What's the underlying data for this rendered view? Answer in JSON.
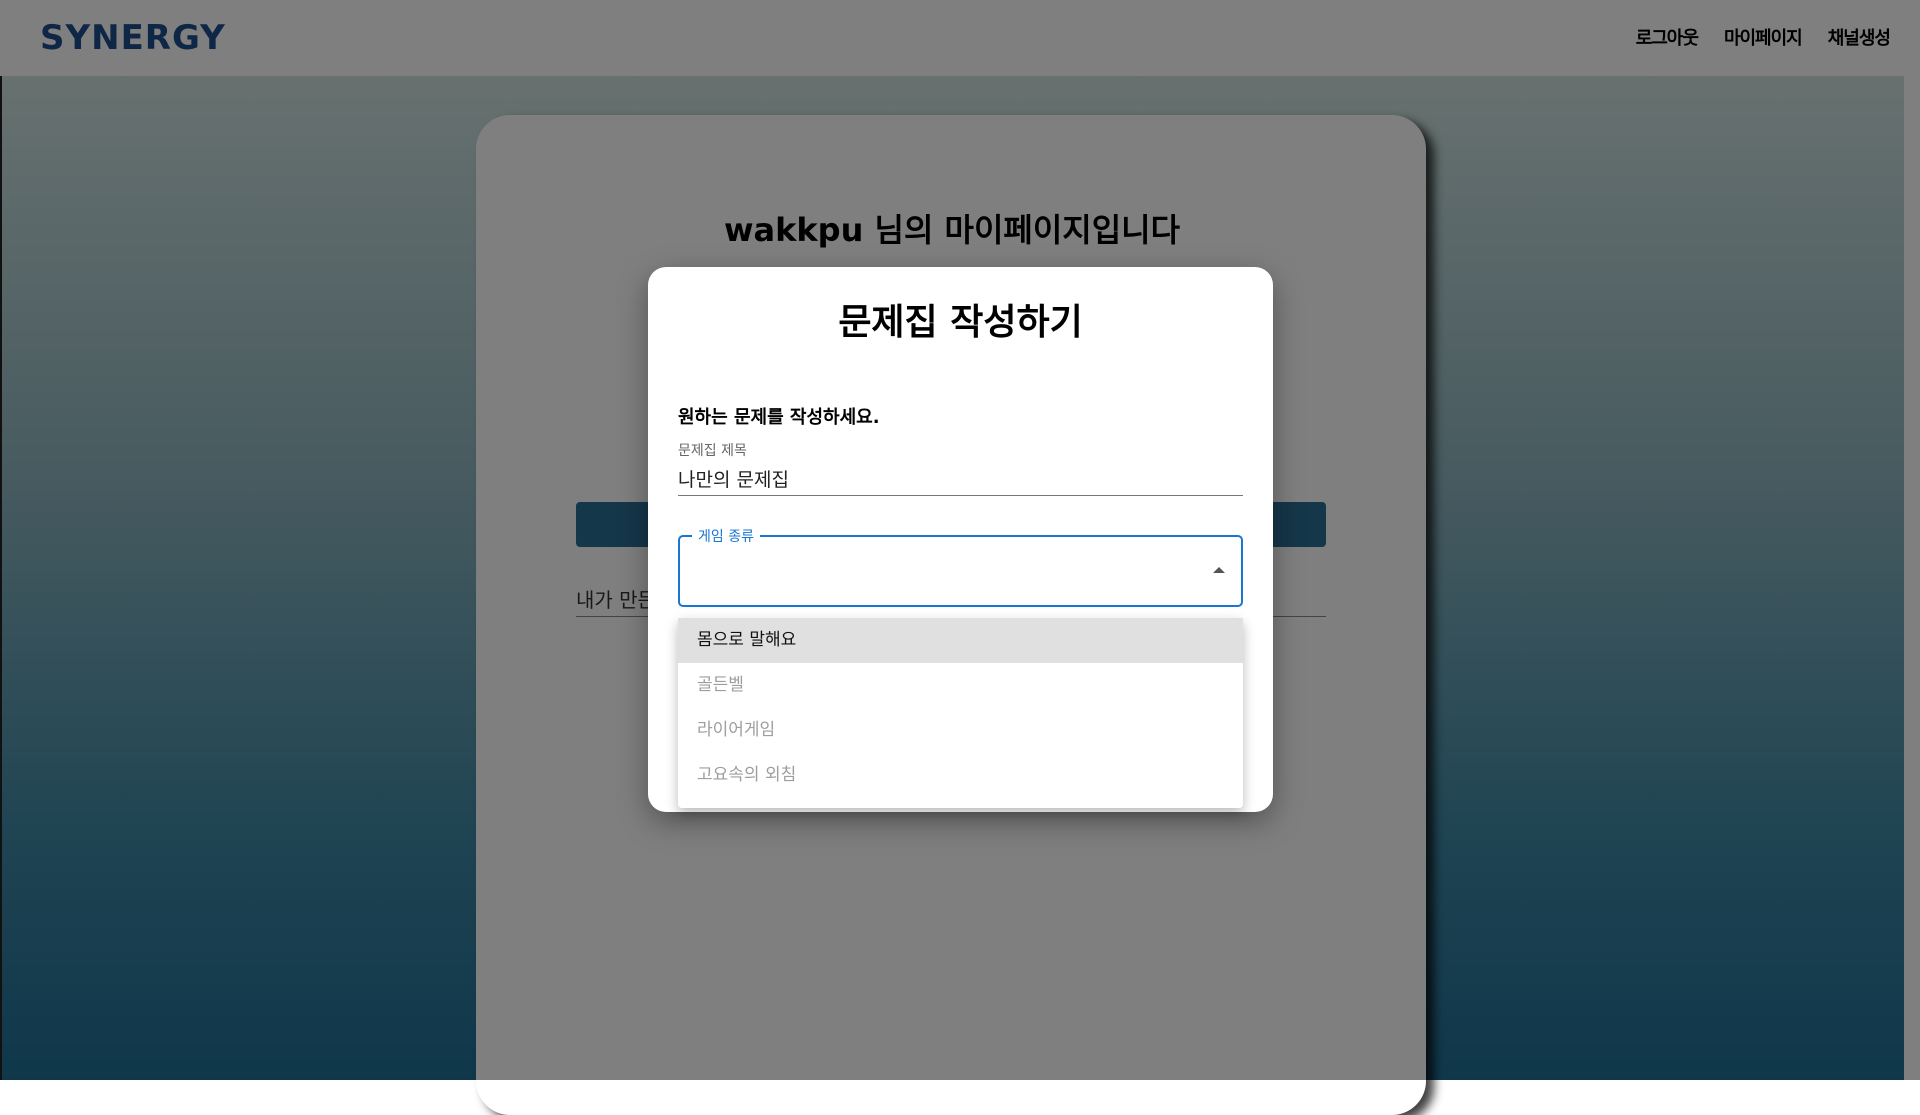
{
  "header": {
    "logo": "SYNERGY",
    "nav": [
      {
        "label": "로그아웃"
      },
      {
        "label": "마이페이지"
      },
      {
        "label": "채널생성"
      }
    ]
  },
  "mypage": {
    "title": "wakkpu 님의 마이페이지입니다",
    "list_label": "내가 만든"
  },
  "modal": {
    "title": "문제집 작성하기",
    "instruction": "원하는 문제를 작성하세요.",
    "title_field": {
      "label": "문제집 제목",
      "value": "나만의 문제집"
    },
    "game_type": {
      "label": "게임 종류",
      "value": "",
      "options": [
        {
          "label": "몸으로 말해요",
          "state": "highlighted"
        },
        {
          "label": "골든벨",
          "state": "normal"
        },
        {
          "label": "라이어게임",
          "state": "normal"
        },
        {
          "label": "고요속의 외침",
          "state": "normal"
        }
      ]
    }
  },
  "colors": {
    "accent": "#1976d2",
    "logo": "#1f4e8c",
    "card_button": "#2b6f94"
  }
}
